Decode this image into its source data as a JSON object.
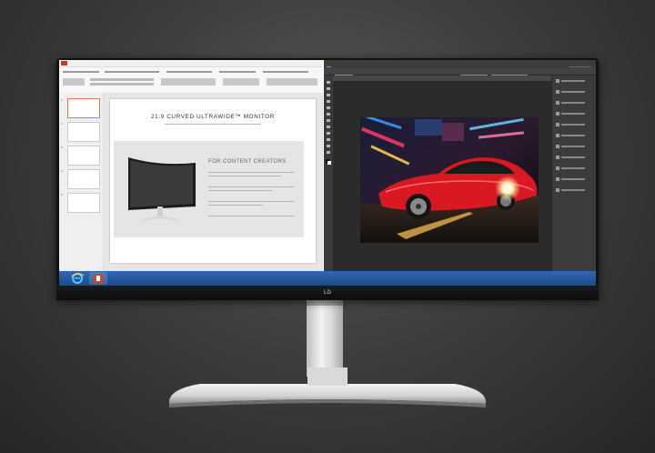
{
  "brand": "LG",
  "colors": {
    "ppt_accent": "#c43e1c",
    "taskbar": "#2e6ab1",
    "ps_dark": "#3c3c3c",
    "car_red": "#d81822"
  },
  "powerpoint": {
    "slide_numbers": [
      "1",
      "2",
      "3",
      "4",
      "5"
    ],
    "slide_title": "21:9 CURVED ULTRAWIDE™ MONITOR",
    "panel_heading": "FOR CONTENT CREATORS"
  },
  "taskbar": {
    "apps": [
      "ie-icon",
      "powerpoint-icon"
    ]
  }
}
